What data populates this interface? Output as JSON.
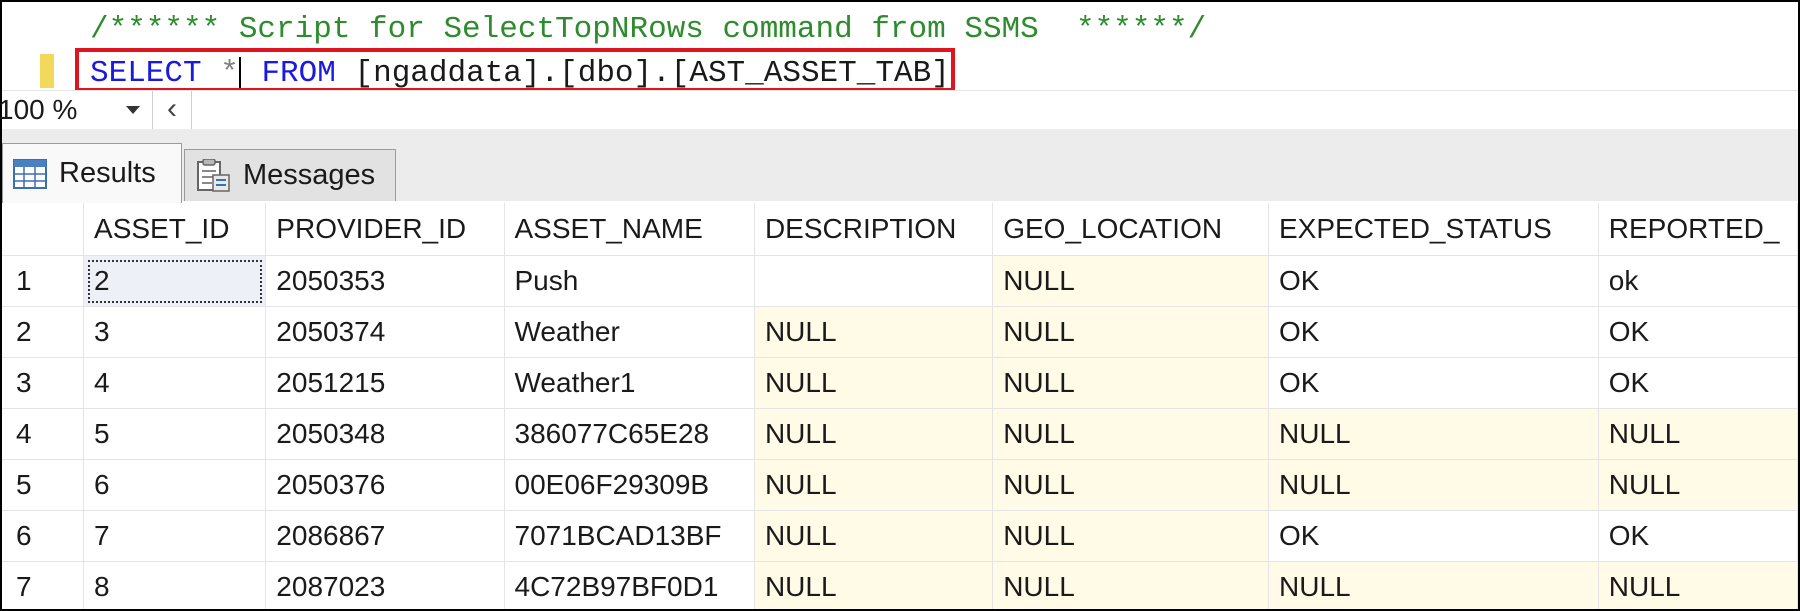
{
  "editor": {
    "comment_line": "/****** Script for SelectTopNRows command from SSMS  ******/",
    "query": {
      "select_kw": "SELECT",
      "star": "*",
      "from_kw": "FROM",
      "table_ref": "[ngaddata].[dbo].[AST_ASSET_TAB]"
    }
  },
  "zoom": {
    "value": "100 %"
  },
  "tabs": [
    {
      "label": "Results",
      "icon": "grid-icon",
      "active": true
    },
    {
      "label": "Messages",
      "icon": "messages-icon",
      "active": false
    }
  ],
  "grid": {
    "columns": [
      "ASSET_ID",
      "PROVIDER_ID",
      "ASSET_NAME",
      "DESCRIPTION",
      "GEO_LOCATION",
      "EXPECTED_STATUS",
      "REPORTED_"
    ],
    "rows": [
      [
        "1",
        "2",
        "2050353",
        "Push",
        "",
        "NULL",
        "OK",
        "ok"
      ],
      [
        "2",
        "3",
        "2050374",
        "Weather",
        "NULL",
        "NULL",
        "OK",
        "OK"
      ],
      [
        "3",
        "4",
        "2051215",
        "Weather1",
        "NULL",
        "NULL",
        "OK",
        "OK"
      ],
      [
        "4",
        "5",
        "2050348",
        "386077C65E28",
        "NULL",
        "NULL",
        "NULL",
        "NULL"
      ],
      [
        "5",
        "6",
        "2050376",
        "00E06F29309B",
        "NULL",
        "NULL",
        "NULL",
        "NULL"
      ],
      [
        "6",
        "7",
        "2086867",
        "7071BCAD13BF",
        "NULL",
        "NULL",
        "OK",
        "OK"
      ],
      [
        "7",
        "8",
        "2087023",
        "4C72B97BF0D1",
        "NULL",
        "NULL",
        "NULL",
        "NULL"
      ]
    ]
  },
  "colors": {
    "comment": "#2e8b2e",
    "keyword": "#1a1adf",
    "highlight_box": "#e0141e",
    "null_cell": "#fffbe6"
  }
}
